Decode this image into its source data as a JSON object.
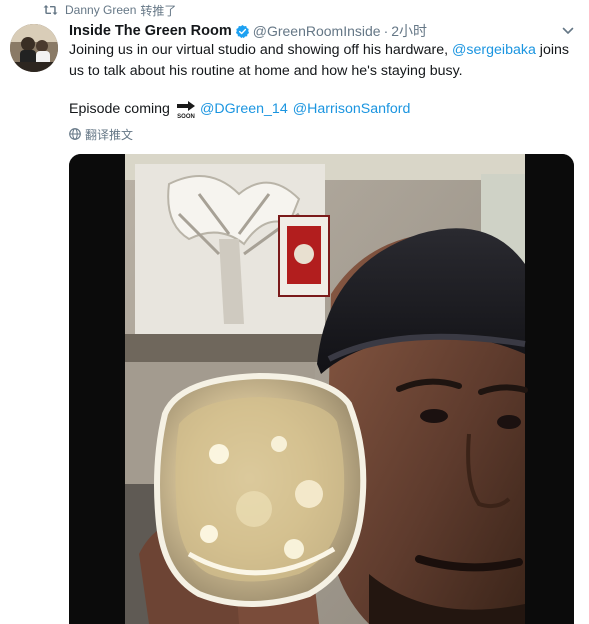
{
  "retweet": {
    "icon": "retweet-icon",
    "name": "Danny Green",
    "action": "转推了"
  },
  "tweet": {
    "display_name": "Inside The Green Room",
    "handle": "@GreenRoomInside",
    "separator": "·",
    "time": "2小时",
    "verified_icon": "verified-badge-icon",
    "caret_icon": "chevron-down-icon",
    "text_part1": "Joining us in our virtual studio and showing off his hardware, ",
    "mention_1": "@sergeibaka",
    "text_part2": " joins us to talk about his routine at home and how he's staying busy.",
    "episode_text": "Episode coming",
    "episode_emoji": "soon-arrow-emoji",
    "mention_2": "@DGreen_14",
    "mention_3": "@HarrisonSanford",
    "translate_label": "翻译推文",
    "translate_icon": "globe-icon"
  },
  "colors": {
    "link": "#1b95e0",
    "secondary": "#657786",
    "verified": "#1da1f2",
    "text": "#14171a"
  },
  "media": {
    "type": "video",
    "icon": "video-thumbnail"
  }
}
